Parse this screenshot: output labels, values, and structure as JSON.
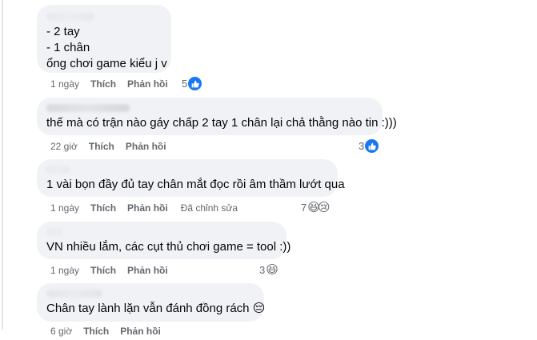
{
  "comments": [
    {
      "lines": [
        "- 2 tay",
        "- 1 chân",
        "ổng chơi game kiểu j v"
      ],
      "time": "1 ngày",
      "like_label": "Thích",
      "reply_label": "Phản hồi",
      "reaction_count": "5",
      "reaction_icons": [
        "like-icon"
      ]
    },
    {
      "lines": [
        "thế mà có trận nào gáy chấp 2 tay 1 chân lại chả thằng nào tin :)))"
      ],
      "time": "22 giờ",
      "like_label": "Thích",
      "reply_label": "Phản hồi",
      "reaction_count": "3",
      "reaction_icons": [
        "like-icon"
      ]
    },
    {
      "lines": [
        "1 vài bọn đầy đủ tay chân mắt đọc rồi âm thầm lướt qua"
      ],
      "time": "1 ngày",
      "like_label": "Thích",
      "reply_label": "Phản hồi",
      "edited_label": "Đã chỉnh sửa",
      "reaction_count": "7",
      "reaction_icons": [
        "grinning-squinting-emoji",
        "sad-tear-emoji"
      ],
      "reaction_glyphs": [
        "😆",
        "😢"
      ]
    },
    {
      "lines": [
        "VN nhiều lắm, các cụt thủ chơi game = tool :))"
      ],
      "time": "1 ngày",
      "like_label": "Thích",
      "reply_label": "Phản hồi",
      "reaction_count": "3",
      "reaction_icons": [
        "grinning-squinting-emoji"
      ],
      "reaction_glyphs": [
        "😆"
      ]
    },
    {
      "lines": [
        "Chân tay lành lặn vẫn đánh đồng rách 😔"
      ],
      "time": "6 giờ",
      "like_label": "Thích",
      "reply_label": "Phản hồi"
    }
  ],
  "colors": {
    "bubble_bg": "#f0f2f5",
    "meta_text": "#65676b",
    "like_blue": "#1877f2",
    "thread_line": "#e4e6eb"
  }
}
